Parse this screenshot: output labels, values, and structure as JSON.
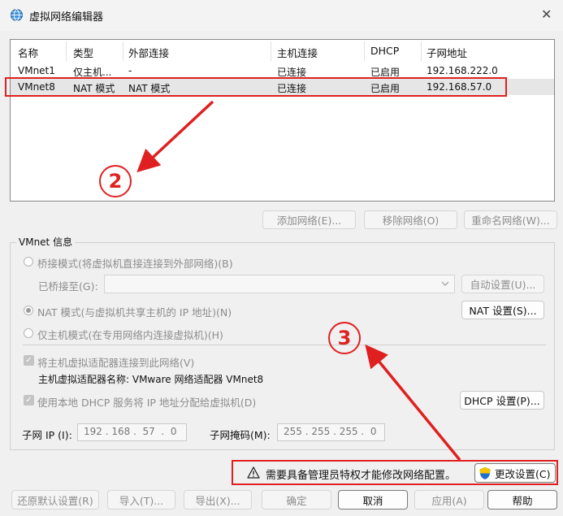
{
  "window": {
    "title": "虚拟网络编辑器",
    "close_glyph": "✕"
  },
  "table": {
    "columns": [
      "名称",
      "类型",
      "外部连接",
      "主机连接",
      "DHCP",
      "子网地址"
    ],
    "rows": [
      [
        "VMnet1",
        "仅主机...",
        "-",
        "已连接",
        "已启用",
        "192.168.222.0"
      ],
      [
        "VMnet8",
        "NAT 模式",
        "NAT 模式",
        "已连接",
        "已启用",
        "192.168.57.0"
      ]
    ]
  },
  "list_buttons": {
    "add": "添加网络(E)...",
    "remove": "移除网络(O)",
    "rename": "重命名网络(W)..."
  },
  "vmnet_info": {
    "legend": "VMnet 信息",
    "bridged_label": "桥接模式(将虚拟机直接连接到外部网络)(B)",
    "bridged_to_label": "已桥接至(G):",
    "auto_settings": "自动设置(U)...",
    "nat_label": "NAT 模式(与虚拟机共享主机的 IP 地址)(N)",
    "nat_settings": "NAT 设置(S)...",
    "hostonly_label": "仅主机模式(在专用网络内连接虚拟机)(H)",
    "connect_adapter_label": "将主机虚拟适配器连接到此网络(V)",
    "adapter_name": "主机虚拟适配器名称: VMware 网络适配器 VMnet8",
    "dhcp_label": "使用本地 DHCP 服务将 IP 地址分配给虚拟机(D)",
    "dhcp_settings": "DHCP 设置(P)...",
    "subnet_ip_label": "子网 IP (I):",
    "subnet_ip_value": "192 . 168 .  57  .  0",
    "subnet_mask_label": "子网掩码(M):",
    "subnet_mask_value": "255 . 255 . 255 .  0"
  },
  "admin": {
    "warning": "需要具备管理员特权才能修改网络配置。",
    "change_settings": "更改设置(C)"
  },
  "footer": {
    "restore": "还原默认设置(R)",
    "import": "导入(T)...",
    "export": "导出(X)...",
    "ok": "确定",
    "cancel": "取消",
    "apply": "应用(A)",
    "help": "帮助"
  },
  "annotations": {
    "step2": "2",
    "step3": "3"
  },
  "colors": {
    "annotation_red": "#e02020",
    "shield_blue": "#1f6fd1",
    "shield_yellow": "#f5c400"
  }
}
